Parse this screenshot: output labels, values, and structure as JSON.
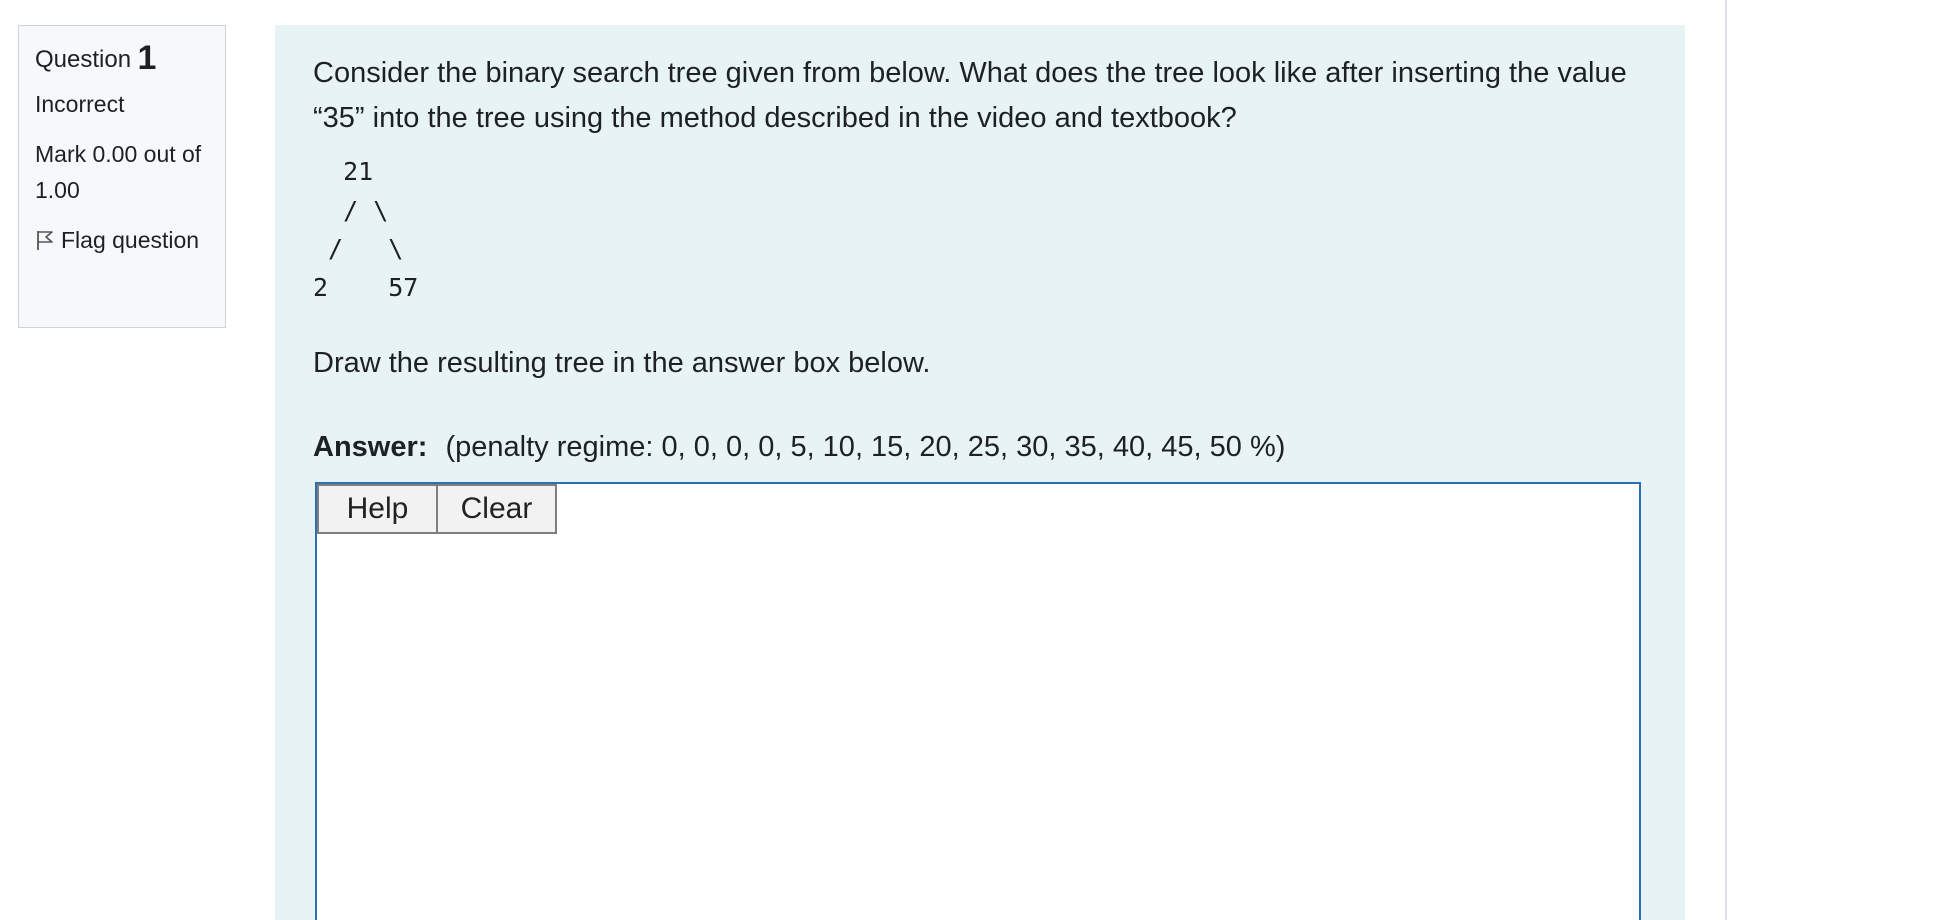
{
  "question_info": {
    "label": "Question",
    "number": "1",
    "status": "Incorrect",
    "mark": "Mark 0.00 out of 1.00",
    "flag_label": "Flag question",
    "flag_icon": "flag-outline-icon"
  },
  "question": {
    "text": "Consider the binary search tree given from below. What does the tree look like after inserting the value “35” into the tree using the method described in the video and textbook?",
    "tree_ascii": "  21\n  / \\\n /   \\\n2    57",
    "instruction": "Draw the resulting tree in the answer box below."
  },
  "answer": {
    "label": "Answer:",
    "penalty": "(penalty regime: 0, 0, 0, 0, 5, 10, 15, 20, 25, 30, 35, 40, 45, 50 %)",
    "help_label": "Help",
    "clear_label": "Clear"
  },
  "colors": {
    "content_bg": "#e7f3f5",
    "answer_border": "#2f6eb5",
    "info_bg": "#f7f8fa"
  }
}
